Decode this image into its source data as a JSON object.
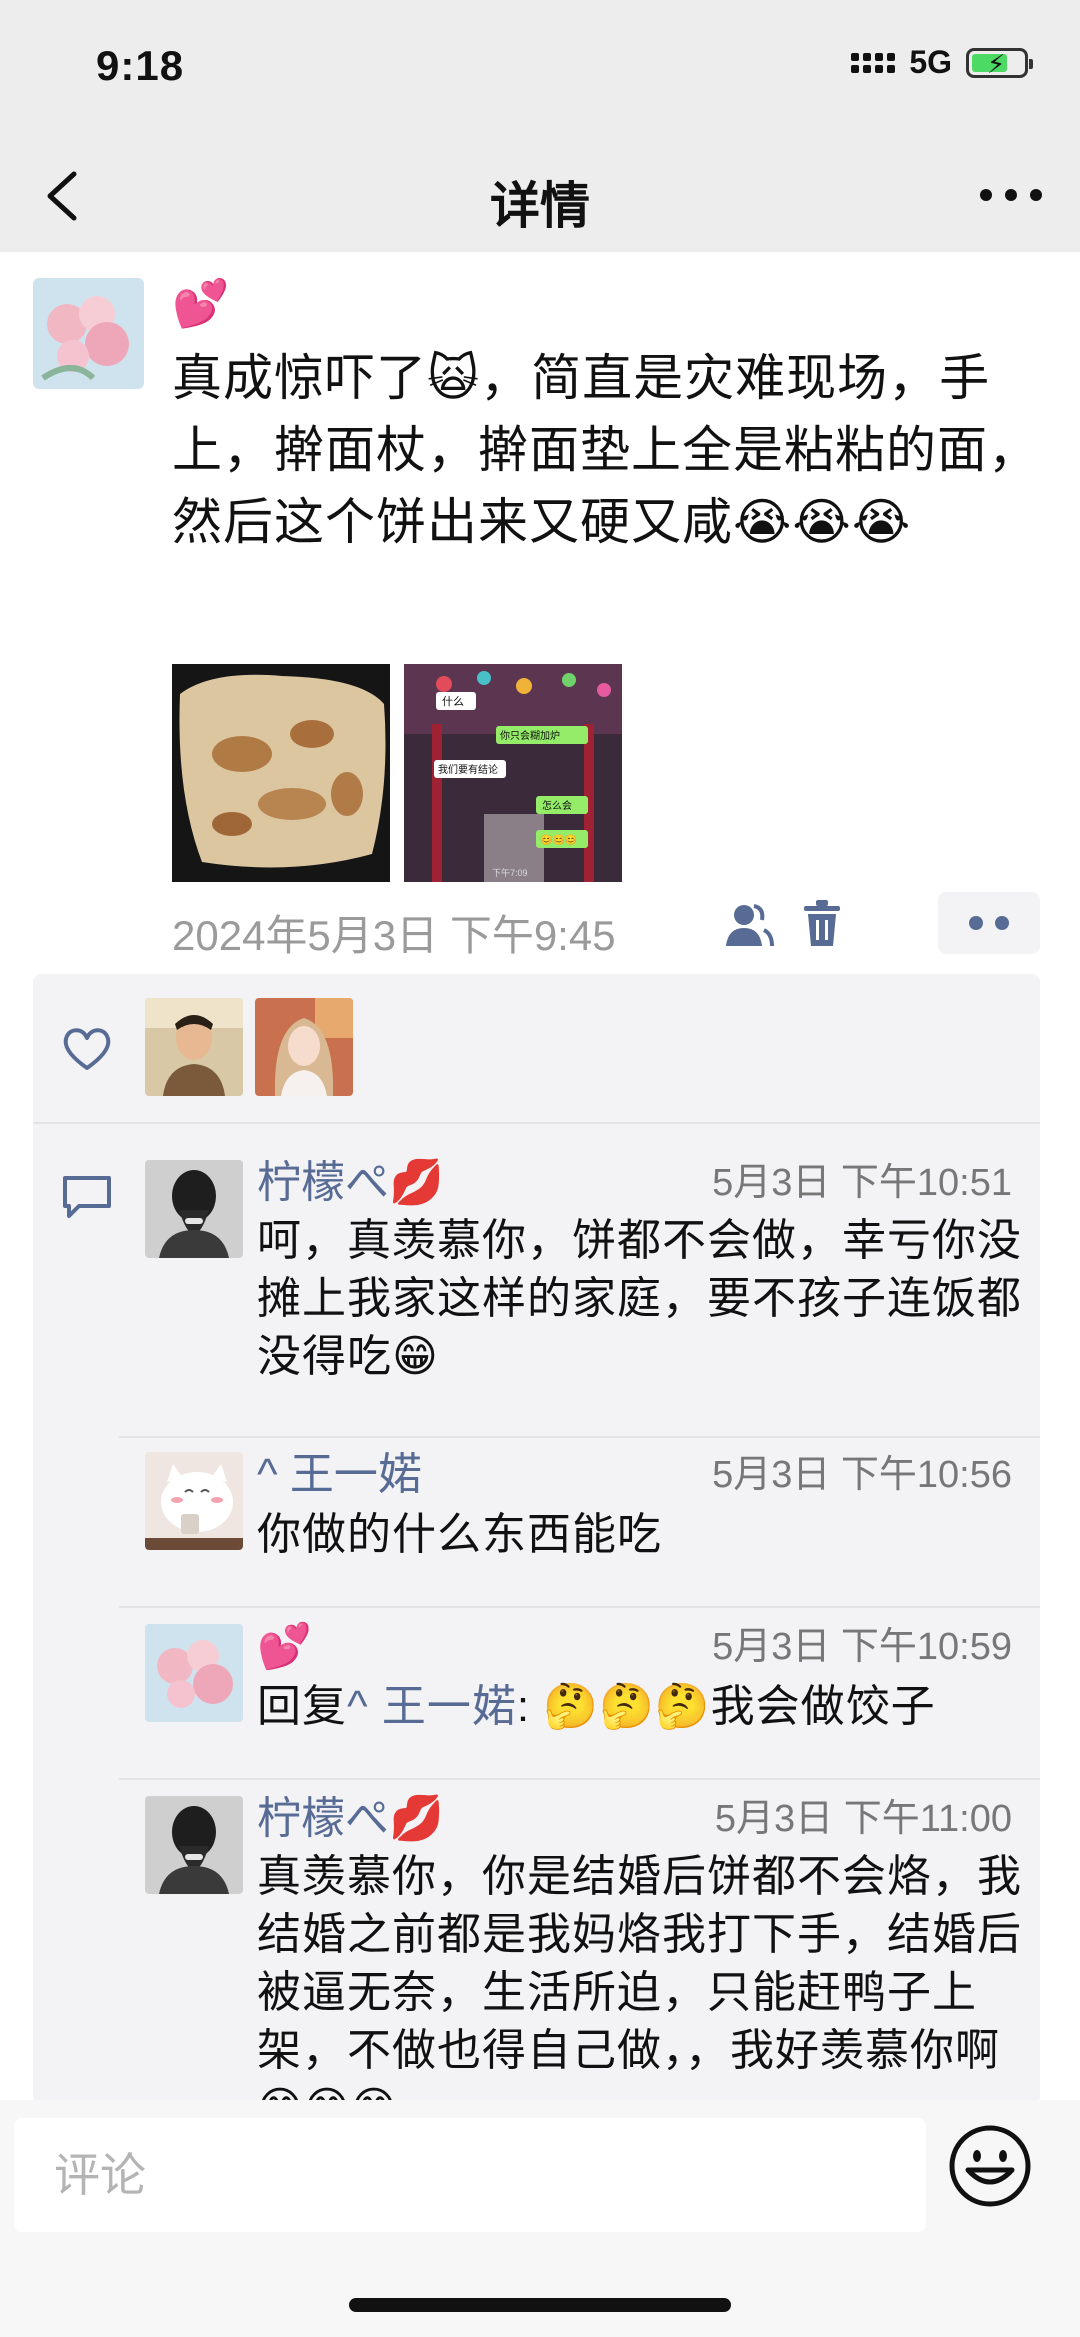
{
  "status_bar": {
    "time": "9:18",
    "network": "5G",
    "battery_icon": "battery-charging-icon",
    "battery_level": 0.7
  },
  "nav": {
    "title": "详情",
    "back_icon": "chevron-left-icon",
    "more_icon": "more-dots-icon"
  },
  "post": {
    "author": "💕",
    "text": "真成惊吓了🙀，简直是灾难现场，手上，擀面杖，擀面垫上全是粘粘的面，然后这个饼出来又硬又咸😭😭😭",
    "time": "2024年5月3日 下午9:45",
    "images": [
      {
        "name": "flatbread-photo"
      },
      {
        "name": "chat-screenshot-photo"
      }
    ],
    "chat_screenshot_texts": [
      "什么",
      "你只会糊加炉",
      "我们要有结论",
      "怎么会",
      "😊😊😊",
      "下午7:09"
    ]
  },
  "likes": {
    "icon": "heart-icon",
    "users": [
      "like-user-1",
      "like-user-2"
    ]
  },
  "comments": {
    "icon": "comment-bubble-icon",
    "items": [
      {
        "name": "柠檬ぺ💋",
        "time": "5月3日 下午10:51",
        "text": "呵，真羡慕你，饼都不会做，幸亏你没摊上我家这样的家庭，要不孩子连饭都没得吃😁"
      },
      {
        "name": "^ 王一婼",
        "time": "5月3日 下午10:56",
        "text": "你做的什么东西能吃"
      },
      {
        "name": "💕",
        "time": "5月3日 下午10:59",
        "reply_prefix": "回复",
        "reply_to": "^ 王一婼",
        "reply_colon": ": ",
        "text": "🤔🤔🤔我会做饺子"
      },
      {
        "name": "柠檬ぺ💋",
        "time": "5月3日 下午11:00",
        "text": "真羡慕你，你是结婚后饼都不会烙，我结婚之前都是我妈烙我打下手，结婚后被逼无奈，生活所迫，只能赶鸭子上架，不做也得自己做，，我好羡慕你啊😁😁😁"
      }
    ]
  },
  "bottom_bar": {
    "placeholder": "评论",
    "emoji_icon": "emoji-smile-icon"
  },
  "colors": {
    "link": "#576b95",
    "header_bg": "#ededed",
    "panel_bg": "#f3f3f5"
  }
}
